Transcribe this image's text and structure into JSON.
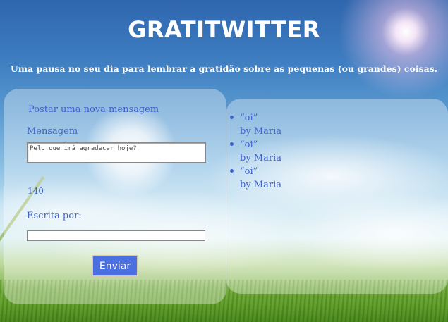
{
  "header": {
    "title": "GRATITWITTER",
    "subtitle": "Uma pausa no seu dia para lembrar a gratidão sobre as pequenas (ou grandes) coisas."
  },
  "form": {
    "heading": "Postar uma nova mensagem",
    "message_label": "Mensagem",
    "message_placeholder": "Pelo que irá agradecer hoje?",
    "message_value": "",
    "char_counter": "140",
    "author_label": "Escrita por:",
    "author_value": "",
    "submit_label": "Enviar"
  },
  "messages": [
    {
      "text": "“oi”",
      "author": "by Maria"
    },
    {
      "text": "“oi”",
      "author": "by Maria"
    },
    {
      "text": "“oi”",
      "author": "by Maria"
    }
  ],
  "colors": {
    "accent": "#3f63c9",
    "button": "#4a6fe0",
    "title": "#ffffff"
  }
}
